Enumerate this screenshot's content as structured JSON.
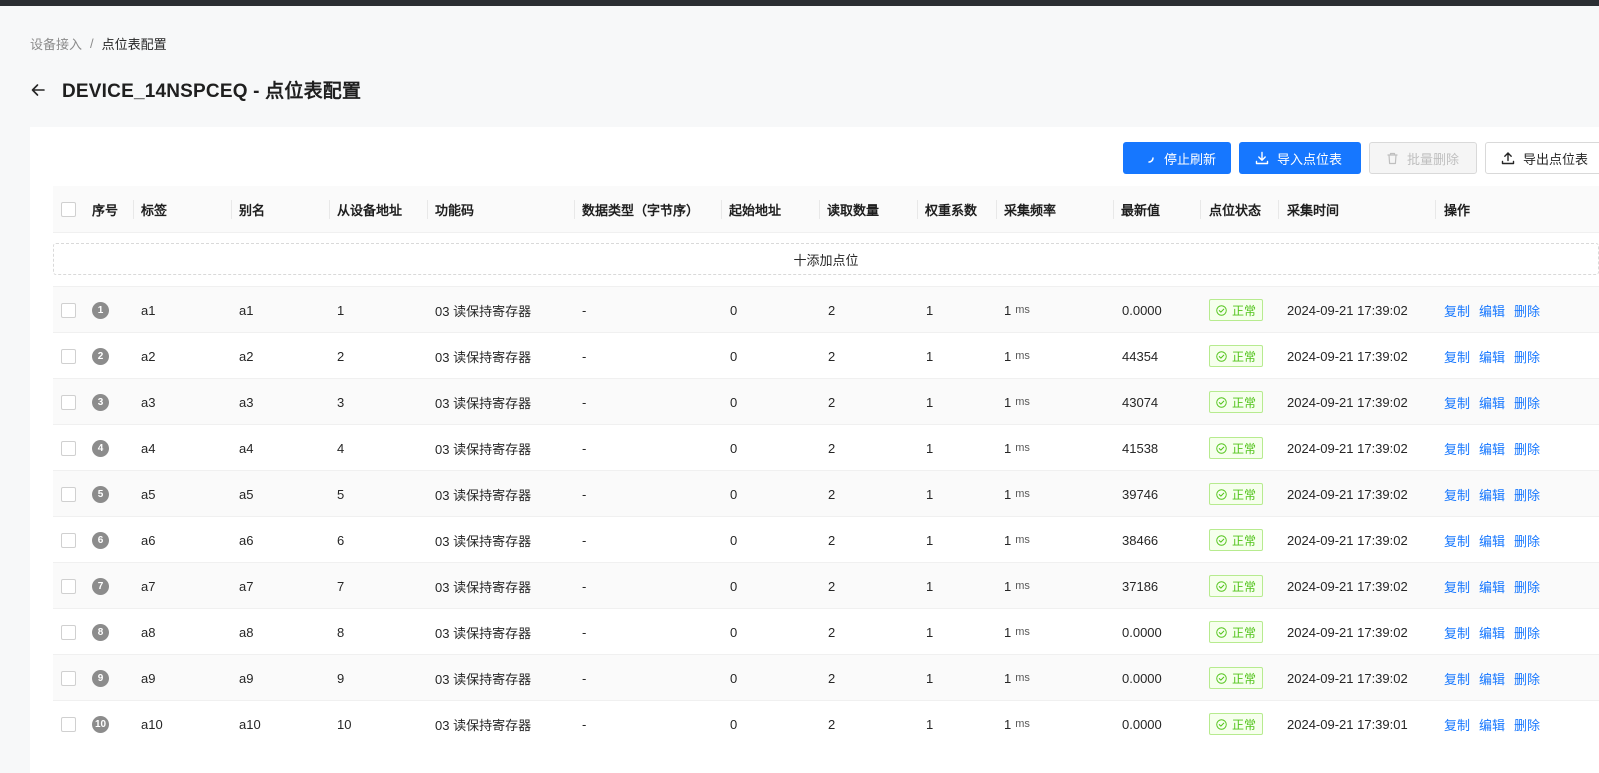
{
  "breadcrumb": {
    "parent": "设备接入",
    "separator": "/",
    "current": "点位表配置"
  },
  "page": {
    "title": "DEVICE_14NSPCEQ - 点位表配置"
  },
  "toolbar": {
    "stop_refresh": "停止刷新",
    "import_points": "导入点位表",
    "batch_delete": "批量删除",
    "export_points": "导出点位表"
  },
  "table": {
    "headers": {
      "index": "序号",
      "tag": "标签",
      "alias": "别名",
      "slave": "从设备地址",
      "func": "功能码",
      "dtype": "数据类型（字节序）",
      "start": "起始地址",
      "count": "读取数量",
      "weight": "权重系数",
      "freq": "采集频率",
      "latest": "最新值",
      "status": "点位状态",
      "time": "采集时间",
      "ops": "操作"
    },
    "add_point": "十添加点位",
    "actions": {
      "copy": "复制",
      "edit": "编辑",
      "delete": "删除"
    },
    "rows": [
      {
        "index": "1",
        "tag": "a1",
        "alias": "a1",
        "slave": "1",
        "func": "03 读保持寄存器",
        "dtype": "-",
        "start": "0",
        "count": "2",
        "weight": "1",
        "freq": "1",
        "unit": "ms",
        "latest": "0.0000",
        "status": "正常",
        "time": "2024-09-21 17:39:02"
      },
      {
        "index": "2",
        "tag": "a2",
        "alias": "a2",
        "slave": "2",
        "func": "03 读保持寄存器",
        "dtype": "-",
        "start": "0",
        "count": "2",
        "weight": "1",
        "freq": "1",
        "unit": "ms",
        "latest": "44354",
        "status": "正常",
        "time": "2024-09-21 17:39:02"
      },
      {
        "index": "3",
        "tag": "a3",
        "alias": "a3",
        "slave": "3",
        "func": "03 读保持寄存器",
        "dtype": "-",
        "start": "0",
        "count": "2",
        "weight": "1",
        "freq": "1",
        "unit": "ms",
        "latest": "43074",
        "status": "正常",
        "time": "2024-09-21 17:39:02"
      },
      {
        "index": "4",
        "tag": "a4",
        "alias": "a4",
        "slave": "4",
        "func": "03 读保持寄存器",
        "dtype": "-",
        "start": "0",
        "count": "2",
        "weight": "1",
        "freq": "1",
        "unit": "ms",
        "latest": "41538",
        "status": "正常",
        "time": "2024-09-21 17:39:02"
      },
      {
        "index": "5",
        "tag": "a5",
        "alias": "a5",
        "slave": "5",
        "func": "03 读保持寄存器",
        "dtype": "-",
        "start": "0",
        "count": "2",
        "weight": "1",
        "freq": "1",
        "unit": "ms",
        "latest": "39746",
        "status": "正常",
        "time": "2024-09-21 17:39:02"
      },
      {
        "index": "6",
        "tag": "a6",
        "alias": "a6",
        "slave": "6",
        "func": "03 读保持寄存器",
        "dtype": "-",
        "start": "0",
        "count": "2",
        "weight": "1",
        "freq": "1",
        "unit": "ms",
        "latest": "38466",
        "status": "正常",
        "time": "2024-09-21 17:39:02"
      },
      {
        "index": "7",
        "tag": "a7",
        "alias": "a7",
        "slave": "7",
        "func": "03 读保持寄存器",
        "dtype": "-",
        "start": "0",
        "count": "2",
        "weight": "1",
        "freq": "1",
        "unit": "ms",
        "latest": "37186",
        "status": "正常",
        "time": "2024-09-21 17:39:02"
      },
      {
        "index": "8",
        "tag": "a8",
        "alias": "a8",
        "slave": "8",
        "func": "03 读保持寄存器",
        "dtype": "-",
        "start": "0",
        "count": "2",
        "weight": "1",
        "freq": "1",
        "unit": "ms",
        "latest": "0.0000",
        "status": "正常",
        "time": "2024-09-21 17:39:02"
      },
      {
        "index": "9",
        "tag": "a9",
        "alias": "a9",
        "slave": "9",
        "func": "03 读保持寄存器",
        "dtype": "-",
        "start": "0",
        "count": "2",
        "weight": "1",
        "freq": "1",
        "unit": "ms",
        "latest": "0.0000",
        "status": "正常",
        "time": "2024-09-21 17:39:02"
      },
      {
        "index": "10",
        "tag": "a10",
        "alias": "a10",
        "slave": "10",
        "func": "03 读保持寄存器",
        "dtype": "-",
        "start": "0",
        "count": "2",
        "weight": "1",
        "freq": "1",
        "unit": "ms",
        "latest": "0.0000",
        "status": "正常",
        "time": "2024-09-21 17:39:01"
      }
    ]
  },
  "colors": {
    "primary": "#1677ff",
    "success": "#52c41a",
    "topbar": "#2b2e33"
  }
}
